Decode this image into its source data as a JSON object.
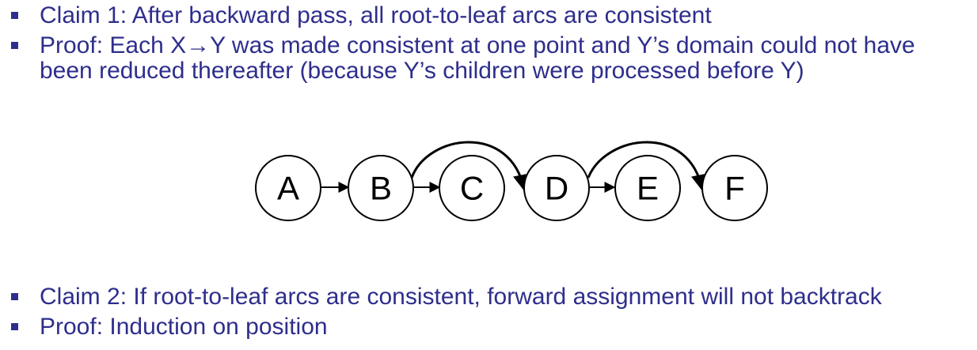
{
  "top_bullets": [
    {
      "lines": [
        "Claim 1: After backward pass, all root-to-leaf arcs are consistent"
      ]
    },
    {
      "lines": [
        "Proof: Each X→Y was made consistent at one point and Y’s domain could not have",
        "been reduced thereafter (because Y’s children were processed before Y)"
      ]
    }
  ],
  "diagram": {
    "nodes": [
      "A",
      "B",
      "C",
      "D",
      "E",
      "F"
    ],
    "straight_arcs": [
      [
        "A",
        "B"
      ],
      [
        "B",
        "C"
      ],
      [
        "D",
        "E"
      ]
    ],
    "curved_arcs": [
      [
        "B",
        "D"
      ],
      [
        "D",
        "F"
      ]
    ]
  },
  "bottom_bullets": [
    {
      "lines": [
        "Claim 2: If root-to-leaf arcs are consistent, forward assignment will not backtrack"
      ]
    },
    {
      "lines": [
        "Proof: Induction on position"
      ]
    }
  ],
  "colors": {
    "text": "#2e2e8c",
    "node_stroke": "#000000"
  }
}
